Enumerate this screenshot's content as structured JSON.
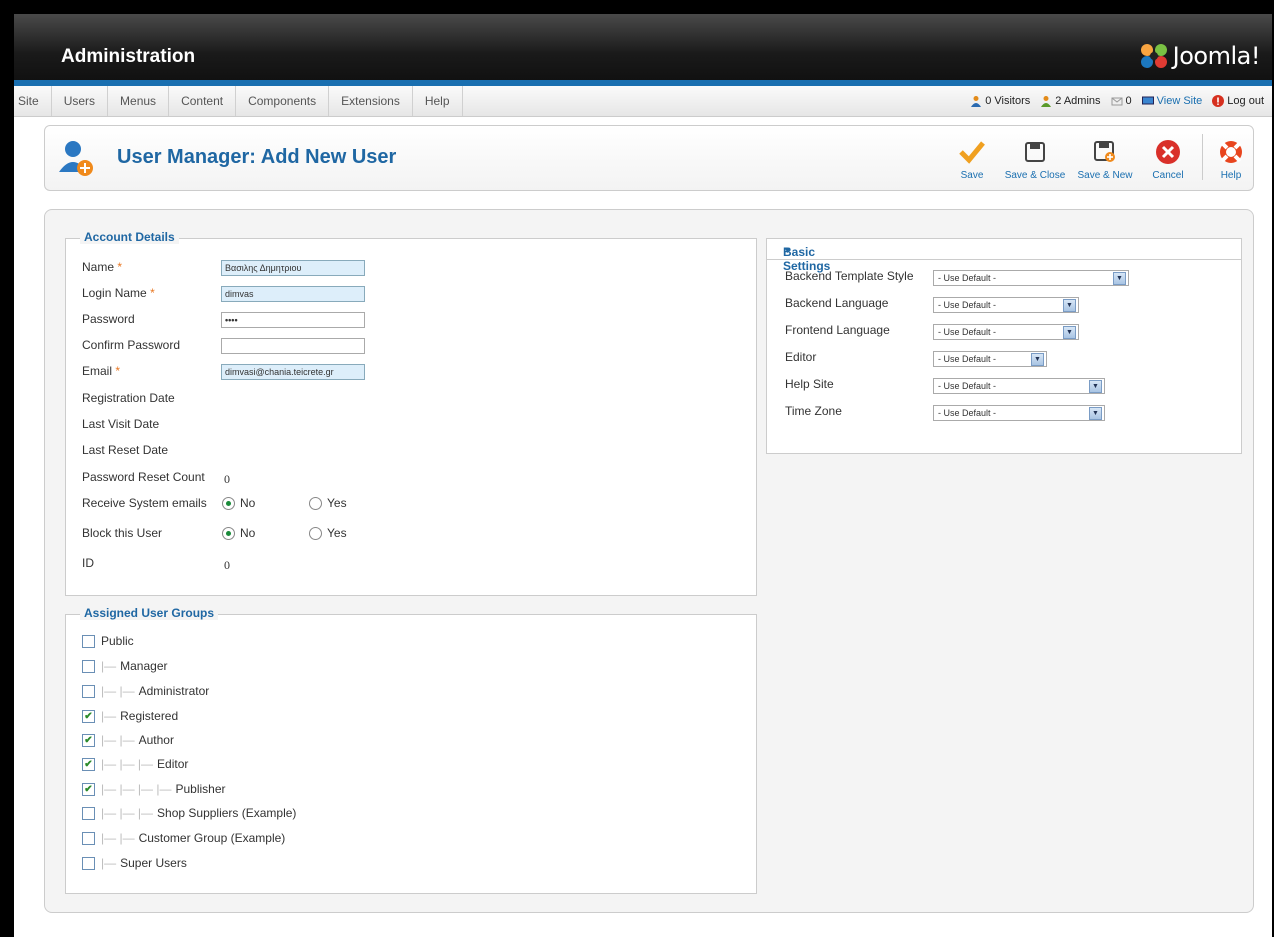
{
  "app": {
    "title": "Administration",
    "logo_text": "Joomla!"
  },
  "menu": [
    {
      "label": "Site"
    },
    {
      "label": "Users"
    },
    {
      "label": "Menus"
    },
    {
      "label": "Content"
    },
    {
      "label": "Components"
    },
    {
      "label": "Extensions"
    },
    {
      "label": "Help"
    }
  ],
  "status": {
    "visitors": "0 Visitors",
    "admins": "2 Admins",
    "messages": "0",
    "view_site": "View Site",
    "logout": "Log out"
  },
  "page": {
    "title": "User Manager: Add New User"
  },
  "toolbar": {
    "save": "Save",
    "save_close": "Save & Close",
    "save_new": "Save & New",
    "cancel": "Cancel",
    "help": "Help"
  },
  "account": {
    "legend": "Account Details",
    "name_label": "Name",
    "name_value": "Βασιλης Δημητριου",
    "login_label": "Login Name",
    "login_value": "dimvas",
    "password_label": "Password",
    "password_value": "••••",
    "confirm_label": "Confirm Password",
    "email_label": "Email",
    "email_value": "dimvasi@chania.teicrete.gr",
    "reg_date_label": "Registration Date",
    "last_visit_label": "Last Visit Date",
    "last_reset_label": "Last Reset Date",
    "reset_count_label": "Password Reset Count",
    "reset_count_value": "0",
    "receive_label": "Receive System emails",
    "block_label": "Block this User",
    "no": "No",
    "yes": "Yes",
    "id_label": "ID",
    "id_value": "0",
    "required_mark": "*"
  },
  "groups": {
    "legend": "Assigned User Groups",
    "items": [
      {
        "label": "Public",
        "checked": false,
        "depth": 0
      },
      {
        "label": "Manager",
        "checked": false,
        "depth": 1
      },
      {
        "label": "Administrator",
        "checked": false,
        "depth": 2
      },
      {
        "label": "Registered",
        "checked": true,
        "depth": 1
      },
      {
        "label": "Author",
        "checked": true,
        "depth": 2
      },
      {
        "label": "Editor",
        "checked": true,
        "depth": 3
      },
      {
        "label": "Publisher",
        "checked": true,
        "depth": 4
      },
      {
        "label": "Shop Suppliers (Example)",
        "checked": false,
        "depth": 3
      },
      {
        "label": "Customer Group (Example)",
        "checked": false,
        "depth": 2
      },
      {
        "label": "Super Users",
        "checked": false,
        "depth": 1
      }
    ]
  },
  "basic": {
    "heading": "Basic Settings",
    "rows": [
      {
        "label": "Backend Template Style",
        "value": "- Use Default -"
      },
      {
        "label": "Backend Language",
        "value": "- Use Default -"
      },
      {
        "label": "Frontend Language",
        "value": "- Use Default -"
      },
      {
        "label": "Editor",
        "value": "- Use Default -"
      },
      {
        "label": "Help Site",
        "value": "- Use Default -"
      },
      {
        "label": "Time Zone",
        "value": "- Use Default -"
      }
    ]
  }
}
